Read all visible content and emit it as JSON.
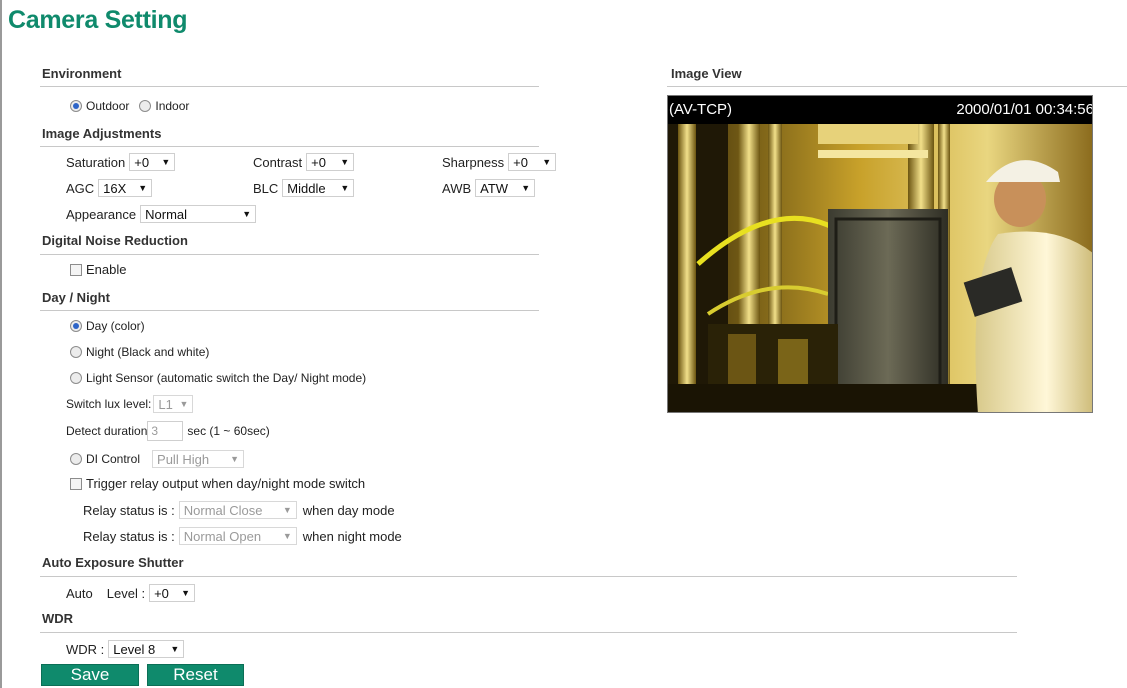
{
  "title": "Camera Setting",
  "environment": {
    "heading": "Environment",
    "outdoor": "Outdoor",
    "indoor": "Indoor",
    "selected": "Outdoor"
  },
  "image_adjustments": {
    "heading": "Image Adjustments",
    "saturation_label": "Saturation",
    "saturation_value": "+0",
    "contrast_label": "Contrast",
    "contrast_value": "+0",
    "sharpness_label": "Sharpness",
    "sharpness_value": "+0",
    "agc_label": "AGC",
    "agc_value": "16X",
    "blc_label": "BLC",
    "blc_value": "Middle",
    "awb_label": "AWB",
    "awb_value": "ATW",
    "appearance_label": "Appearance",
    "appearance_value": "Normal"
  },
  "dnr": {
    "heading": "Digital Noise Reduction",
    "enable_label": "Enable"
  },
  "day_night": {
    "heading": "Day / Night",
    "day": "Day (color)",
    "night": "Night (Black and white)",
    "light_sensor": "Light Sensor (automatic switch the Day/ Night mode)",
    "switch_lux_label": "Switch lux level:",
    "switch_lux_value": "L1",
    "detect_label": "Detect duration",
    "detect_value": "3",
    "detect_suffix": "sec (1 ~ 60sec)",
    "di_label": "DI Control",
    "di_value": "Pull High",
    "trigger_label": "Trigger relay output when day/night mode switch",
    "relay_label": "Relay status is :",
    "relay_day_value": "Normal Close",
    "relay_day_suffix": "when day mode",
    "relay_night_value": "Normal Open",
    "relay_night_suffix": "when night mode"
  },
  "shutter": {
    "heading": "Auto Exposure Shutter",
    "auto_label": "Auto",
    "level_label": "Level :",
    "level_value": "+0"
  },
  "wdr": {
    "heading": "WDR",
    "label": "WDR :",
    "value": "Level 8"
  },
  "buttons": {
    "save": "Save",
    "reset": "Reset"
  },
  "image_view": {
    "heading": "Image View",
    "overlay_left": "(AV-TCP)",
    "overlay_right": "2000/01/01 00:34:56"
  },
  "colors": {
    "accent": "#0f8a6c",
    "radio_dot": "#2d64c8"
  }
}
